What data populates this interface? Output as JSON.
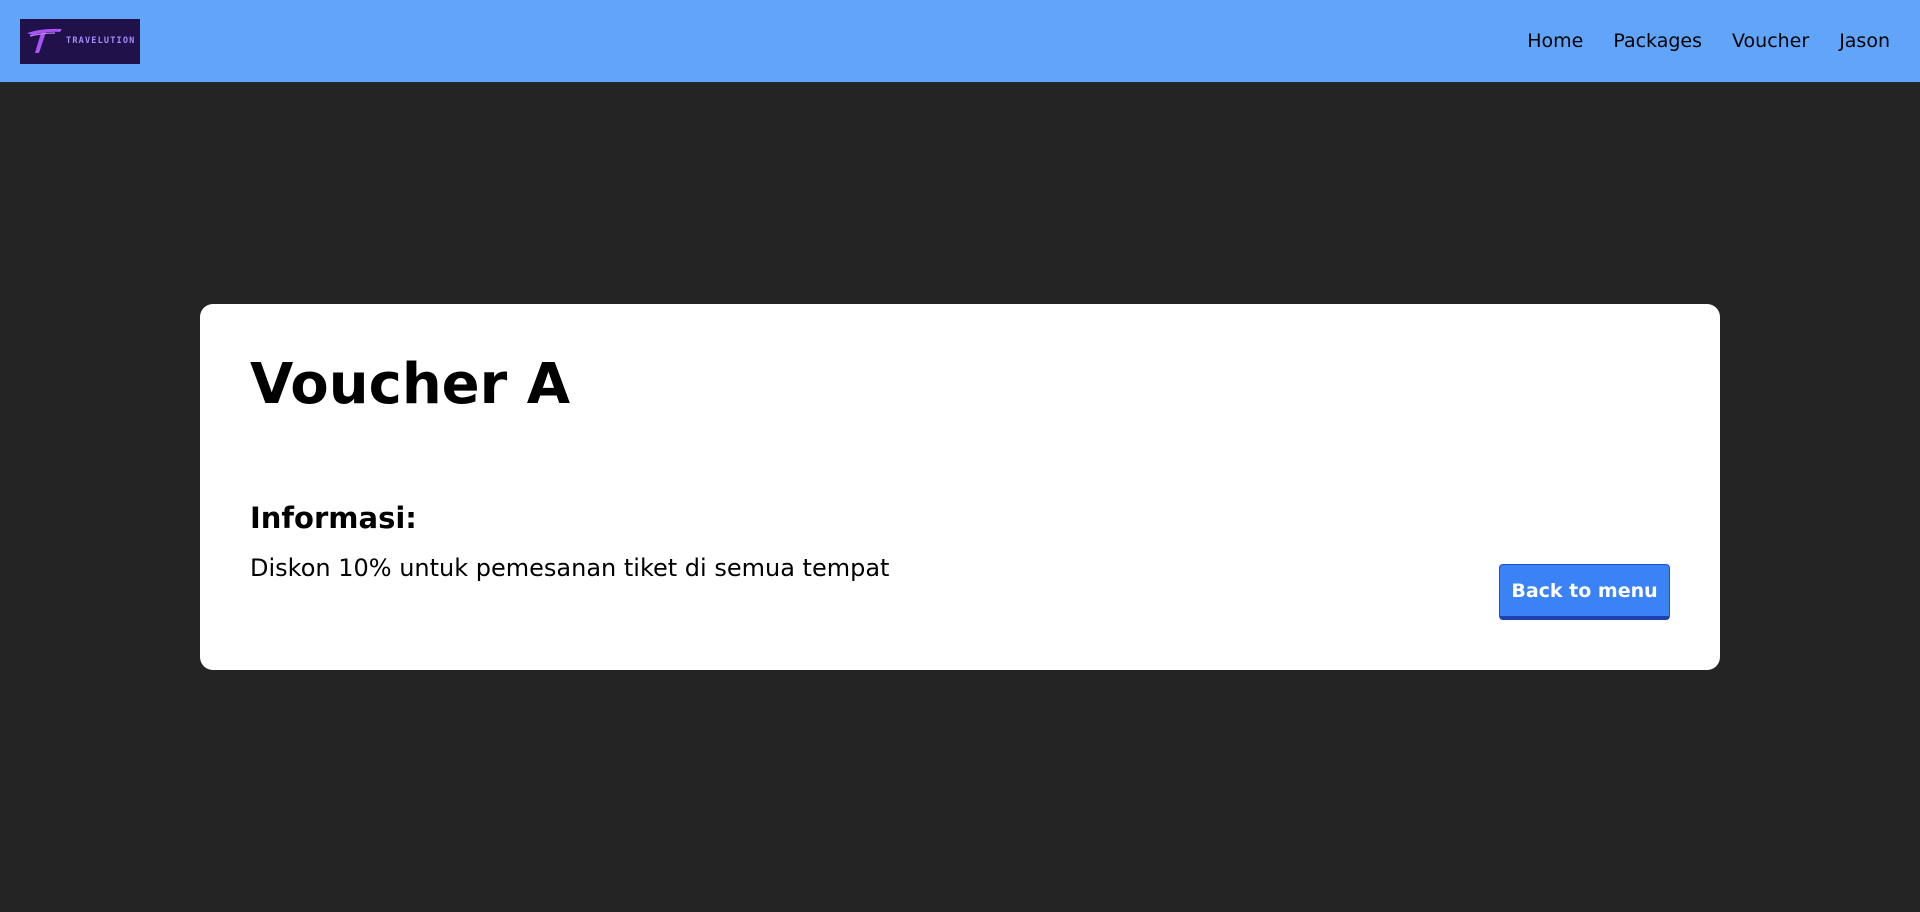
{
  "brand": {
    "logo_text": "TRAVELUTION",
    "logo_icon": "stylized-t-icon",
    "colors": {
      "logo_bg": "#21114a",
      "logo_accent": "#a78bfa"
    }
  },
  "nav": {
    "items": [
      {
        "label": "Home"
      },
      {
        "label": "Packages"
      },
      {
        "label": "Voucher"
      },
      {
        "label": "Jason"
      }
    ]
  },
  "voucher": {
    "title": "Voucher A",
    "info_label": "Informasi:",
    "info_text": "Diskon 10% untuk pemesanan tiket di semua tempat",
    "back_button_label": "Back to menu"
  },
  "colors": {
    "navbar_bg": "#60a5fa",
    "page_bg": "#242424",
    "card_bg": "#ffffff",
    "button_bg": "#3b82f6"
  }
}
